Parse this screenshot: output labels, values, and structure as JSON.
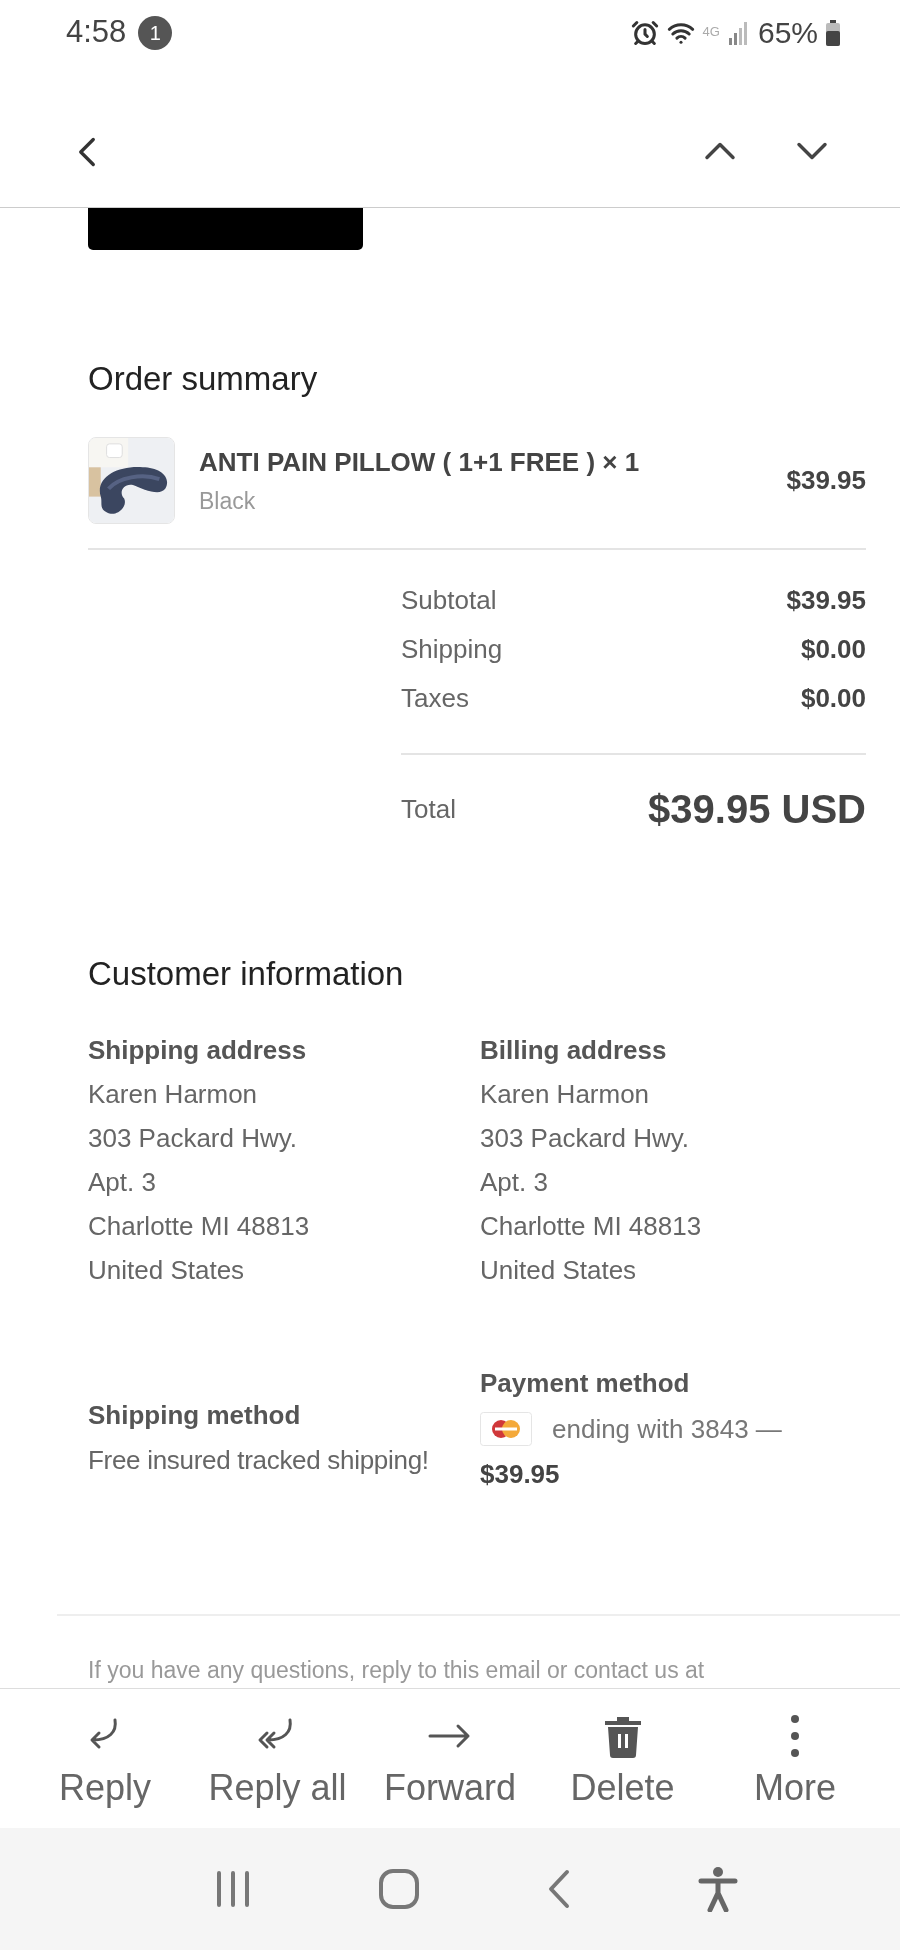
{
  "status_bar": {
    "time": "4:58",
    "notification_count": "1",
    "network": "4G",
    "battery": "65%"
  },
  "order_summary": {
    "title": "Order summary",
    "items": [
      {
        "name": "ANTI PAIN PILLOW ( 1+1 FREE ) × 1",
        "variant": "Black",
        "price": "$39.95"
      }
    ],
    "lines": [
      {
        "label": "Subtotal",
        "value": "$39.95"
      },
      {
        "label": "Shipping",
        "value": "$0.00"
      },
      {
        "label": "Taxes",
        "value": "$0.00"
      }
    ],
    "total": {
      "label": "Total",
      "value": "$39.95 USD"
    }
  },
  "customer_information": {
    "title": "Customer information",
    "addresses": [
      {
        "heading": "Shipping address",
        "lines": [
          "Karen Harmon",
          "303 Packard Hwy.",
          "Apt. 3",
          "Charlotte MI 48813",
          "United States"
        ]
      },
      {
        "heading": "Billing address",
        "lines": [
          "Karen Harmon",
          "303 Packard Hwy.",
          "Apt. 3",
          "Charlotte MI 48813",
          "United States"
        ]
      }
    ],
    "shipping_method": {
      "heading": "Shipping method",
      "value": "Free insured tracked shipping!"
    },
    "payment_method": {
      "heading": "Payment method",
      "card_text": "ending with 3843 —",
      "amount": "$39.95"
    }
  },
  "footer_text": "If you have any questions, reply to this email or contact us at",
  "actions": [
    {
      "kind": "reply",
      "label": "Reply"
    },
    {
      "kind": "reply_all",
      "label": "Reply all"
    },
    {
      "kind": "forward",
      "label": "Forward"
    },
    {
      "kind": "delete",
      "label": "Delete"
    },
    {
      "kind": "more",
      "label": "More"
    }
  ]
}
